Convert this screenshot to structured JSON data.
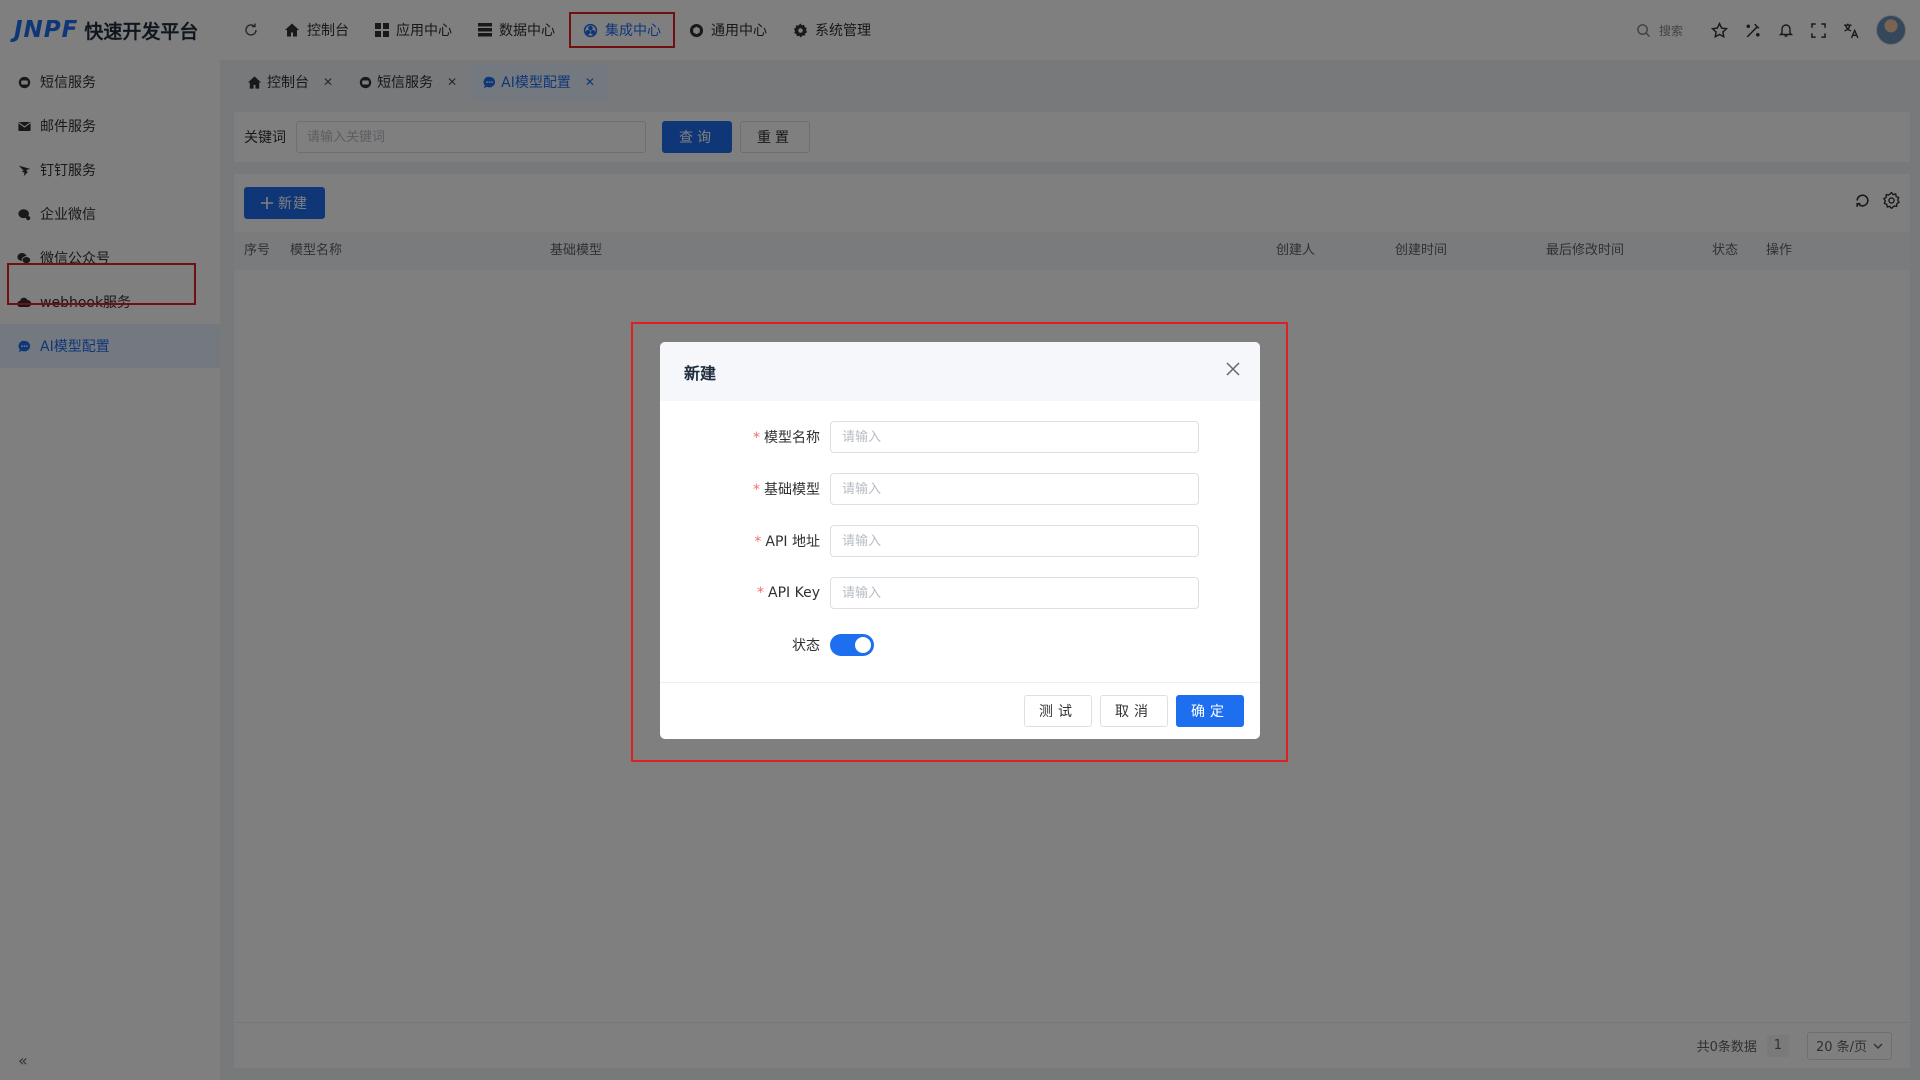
{
  "app": {
    "logo": "JNPF",
    "title": "快速开发平台"
  },
  "topnav": [
    {
      "label": "控制台",
      "icon": "home-icon"
    },
    {
      "label": "应用中心",
      "icon": "grid-icon"
    },
    {
      "label": "数据中心",
      "icon": "database-icon"
    },
    {
      "label": "集成中心",
      "icon": "integration-icon",
      "active": true
    },
    {
      "label": "通用中心",
      "icon": "cube-icon"
    },
    {
      "label": "系统管理",
      "icon": "gear-icon"
    }
  ],
  "header": {
    "search_label": "搜索"
  },
  "sidebar": {
    "items": [
      {
        "label": "短信服务",
        "icon": "sms-icon"
      },
      {
        "label": "邮件服务",
        "icon": "mail-icon"
      },
      {
        "label": "钉钉服务",
        "icon": "dingtalk-icon"
      },
      {
        "label": "企业微信",
        "icon": "wecom-icon"
      },
      {
        "label": "微信公众号",
        "icon": "wechat-icon"
      },
      {
        "label": "webhook服务",
        "icon": "webhook-icon"
      },
      {
        "label": "AI模型配置",
        "icon": "chat-bubble-icon",
        "active": true
      }
    ]
  },
  "tabs": [
    {
      "label": "控制台"
    },
    {
      "label": "短信服务"
    },
    {
      "label": "AI模型配置",
      "active": true
    }
  ],
  "search": {
    "keyword_label": "关键词",
    "keyword_placeholder": "请输入关键词",
    "query_button": "查询",
    "reset_button": "重置"
  },
  "toolbar": {
    "new_button": "新建"
  },
  "table": {
    "columns": [
      "序号",
      "模型名称",
      "基础模型",
      "创建人",
      "创建时间",
      "最后修改时间",
      "状态",
      "操作"
    ],
    "rows": []
  },
  "pagination": {
    "total_text": "共0条数据",
    "current_page": "1",
    "page_size": "20 条/页"
  },
  "dialog": {
    "title": "新建",
    "fields": [
      {
        "label": "模型名称",
        "required": "*",
        "placeholder": "请输入",
        "value": ""
      },
      {
        "label": "基础模型",
        "required": "*",
        "placeholder": "请输入",
        "value": ""
      },
      {
        "label": "API 地址",
        "required": "*",
        "placeholder": "请输入",
        "value": ""
      },
      {
        "label": "API Key",
        "required": "*",
        "placeholder": "请输入",
        "value": ""
      }
    ],
    "status_label": "状态",
    "status_on": true,
    "test_button": "测试",
    "cancel_button": "取消",
    "confirm_button": "确定"
  },
  "colors": {
    "primary": "#1e6ff0",
    "highlight_border": "#e02020",
    "required": "#f56c6c"
  }
}
